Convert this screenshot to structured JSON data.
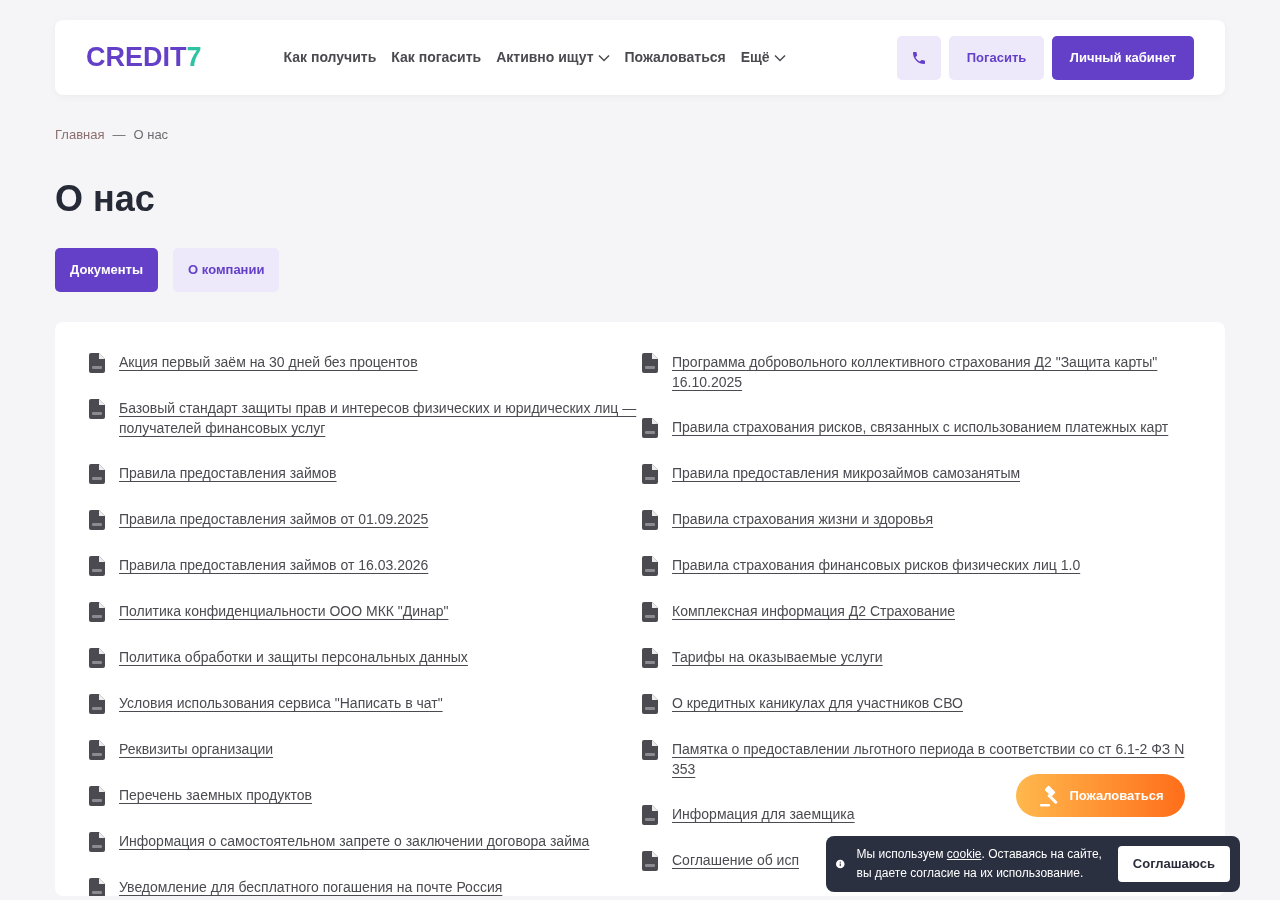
{
  "header": {
    "logo": {
      "text": "CREDIT",
      "accent": "7"
    },
    "nav": [
      {
        "label": "Как получить",
        "dropdown": false
      },
      {
        "label": "Как погасить",
        "dropdown": false
      },
      {
        "label": "Активно ищут",
        "dropdown": true
      },
      {
        "label": "Пожаловаться",
        "dropdown": false
      },
      {
        "label": "Ещё",
        "dropdown": true
      }
    ],
    "repay_button": "Погасить",
    "account_button": "Личный кабинет"
  },
  "breadcrumbs": [
    "Главная",
    "О нас"
  ],
  "breadcrumb_separator": "—",
  "title": "О нас",
  "tabs": [
    {
      "label": "Документы",
      "selected": true
    },
    {
      "label": "О компании",
      "selected": false
    }
  ],
  "documents": {
    "left": [
      "Акция первый заём на 30 дней без процентов",
      "Базовый стандарт защиты прав и интересов физических и юридических лиц — получателей финансовых услуг",
      "Правила предоставления займов",
      "Правила предоставления займов от 01.09.2025",
      "Правила предоставления займов от 16.03.2026",
      "Политика конфиденциальности ООО МКК \"Динар\"",
      "Политика обработки и защиты персональных данных",
      "Условия использования сервиса \"Написать в чат\"",
      "Реквизиты организации",
      "Перечень заемных продуктов",
      "Информация о самостоятельном запрете о заключении договора займа",
      "Уведомление для бесплатного погашения на почте Россия"
    ],
    "right": [
      "Программа добровольного коллективного страхования Д2 \"Защита карты\" 16.10.2025",
      "Правила страхования рисков, связанных с использованием платежных карт",
      "Правила предоставления микрозаймов самозанятым",
      "Правила страхования жизни и здоровья",
      "Правила страхования финансовых рисков физических лиц 1.0",
      "Комплексная информация Д2 Страхование",
      "Тарифы на оказываемые услуги",
      "О кредитных каникулах для участников СВО",
      "Памятка о предоставлении льготного периода в соответствии со ст 6.1-2 ФЗ N 353",
      "Информация для заемщика",
      "Соглашение об исп"
    ]
  },
  "complaint_button": "Пожаловаться",
  "cookie_banner": {
    "text_before": "Мы используем ",
    "link": "cookie",
    "text_after": ". Оставаясь на сайте, вы даете согласие на их использование.",
    "button": "Соглашаюсь"
  }
}
